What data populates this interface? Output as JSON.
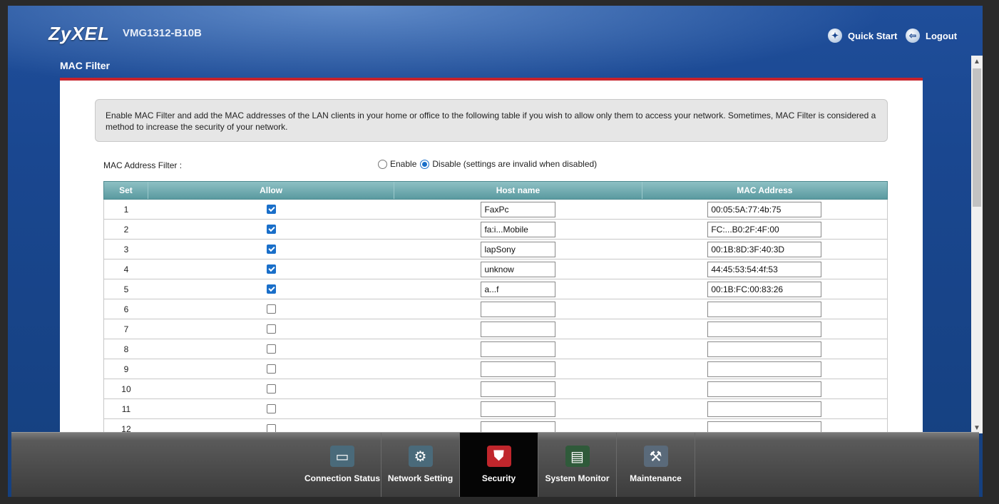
{
  "header": {
    "logo": "ZyXEL",
    "model": "VMG1312-B10B",
    "quick_start": "Quick Start",
    "logout": "Logout"
  },
  "page": {
    "title": "MAC Filter"
  },
  "info": {
    "text": "Enable MAC Filter and add the MAC addresses of the LAN clients in your home or office to the following table if you wish to allow only them to access your network. Sometimes, MAC Filter is considered a method to increase the security of your network."
  },
  "filter": {
    "label": "MAC Address Filter :",
    "enable_label": "Enable",
    "disable_label": "Disable (settings are invalid when disabled)",
    "selected": "disable"
  },
  "table": {
    "headers": {
      "set": "Set",
      "allow": "Allow",
      "host": "Host name",
      "mac": "MAC Address"
    },
    "rows": [
      {
        "set": "1",
        "allow": true,
        "host": "FaxPc",
        "mac": "00:05:5A:77:4b:75"
      },
      {
        "set": "2",
        "allow": true,
        "host": "fa:i...Mobile",
        "mac": "FC:...B0:2F:4F:00"
      },
      {
        "set": "3",
        "allow": true,
        "host": "lapSony",
        "mac": "00:1B:8D:3F:40:3D"
      },
      {
        "set": "4",
        "allow": true,
        "host": "unknow",
        "mac": "44:45:53:54:4f:53"
      },
      {
        "set": "5",
        "allow": true,
        "host": "a...f",
        "mac": "00:1B:FC:00:83:26"
      },
      {
        "set": "6",
        "allow": false,
        "host": "",
        "mac": ""
      },
      {
        "set": "7",
        "allow": false,
        "host": "",
        "mac": ""
      },
      {
        "set": "8",
        "allow": false,
        "host": "",
        "mac": ""
      },
      {
        "set": "9",
        "allow": false,
        "host": "",
        "mac": ""
      },
      {
        "set": "10",
        "allow": false,
        "host": "",
        "mac": ""
      },
      {
        "set": "11",
        "allow": false,
        "host": "",
        "mac": ""
      },
      {
        "set": "12",
        "allow": false,
        "host": "",
        "mac": ""
      }
    ]
  },
  "nav": [
    {
      "label": "Connection Status",
      "icon": "monitor-icon",
      "active": false
    },
    {
      "label": "Network Setting",
      "icon": "gear-icon",
      "active": false
    },
    {
      "label": "Security",
      "icon": "shield-icon",
      "active": true
    },
    {
      "label": "System Monitor",
      "icon": "chart-icon",
      "active": false
    },
    {
      "label": "Maintenance",
      "icon": "tools-icon",
      "active": false
    }
  ],
  "colors": {
    "accent_red": "#c8232c",
    "header_blue": "#1a4790",
    "table_teal": "#5a9aa0",
    "check_blue": "#1a6fc9"
  }
}
